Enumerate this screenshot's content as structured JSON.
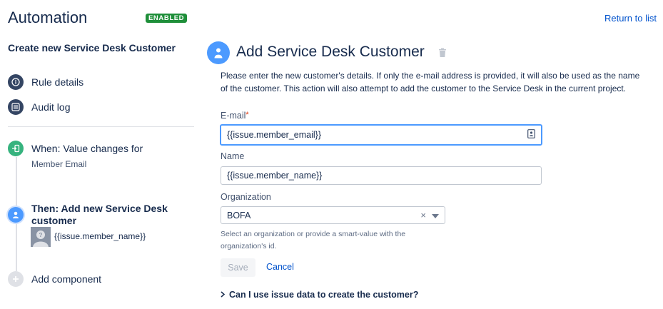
{
  "header": {
    "title": "Automation",
    "status_badge": "ENABLED",
    "return_link": "Return to list"
  },
  "sidebar": {
    "rule_name": "Create new Service Desk Customer",
    "nav": [
      {
        "label": "Rule details",
        "icon": "info-icon"
      },
      {
        "label": "Audit log",
        "icon": "list-icon"
      }
    ],
    "trigger": {
      "title": "When: Value changes for",
      "subtitle": "Member Email",
      "icon": "trigger-icon"
    },
    "action": {
      "title": "Then: Add new Service Desk customer",
      "value": "{{issue.member_name}}",
      "icon": "user-icon"
    },
    "add_component": {
      "label": "Add component",
      "icon": "plus-icon"
    }
  },
  "main": {
    "title": "Add Service Desk Customer",
    "description": "Please enter the new customer's details. If only the e-mail address is provided, it will also be used as the name of the customer. This action will also attempt to add the customer to the Service Desk in the current project.",
    "email": {
      "label": "E-mail",
      "required_mark": "*",
      "value": "{{issue.member_email}}"
    },
    "name": {
      "label": "Name",
      "value": "{{issue.member_name}}"
    },
    "organization": {
      "label": "Organization",
      "value": "BOFA",
      "help": "Select an organization or provide a smart-value with the organization's id."
    },
    "save_label": "Save",
    "cancel_label": "Cancel",
    "faq_label": "Can I use issue data to create the customer?"
  },
  "colors": {
    "accent": "#0052cc",
    "badge": "#1f8f3a",
    "focus": "#4c9aff",
    "trigger": "#36b37e"
  }
}
